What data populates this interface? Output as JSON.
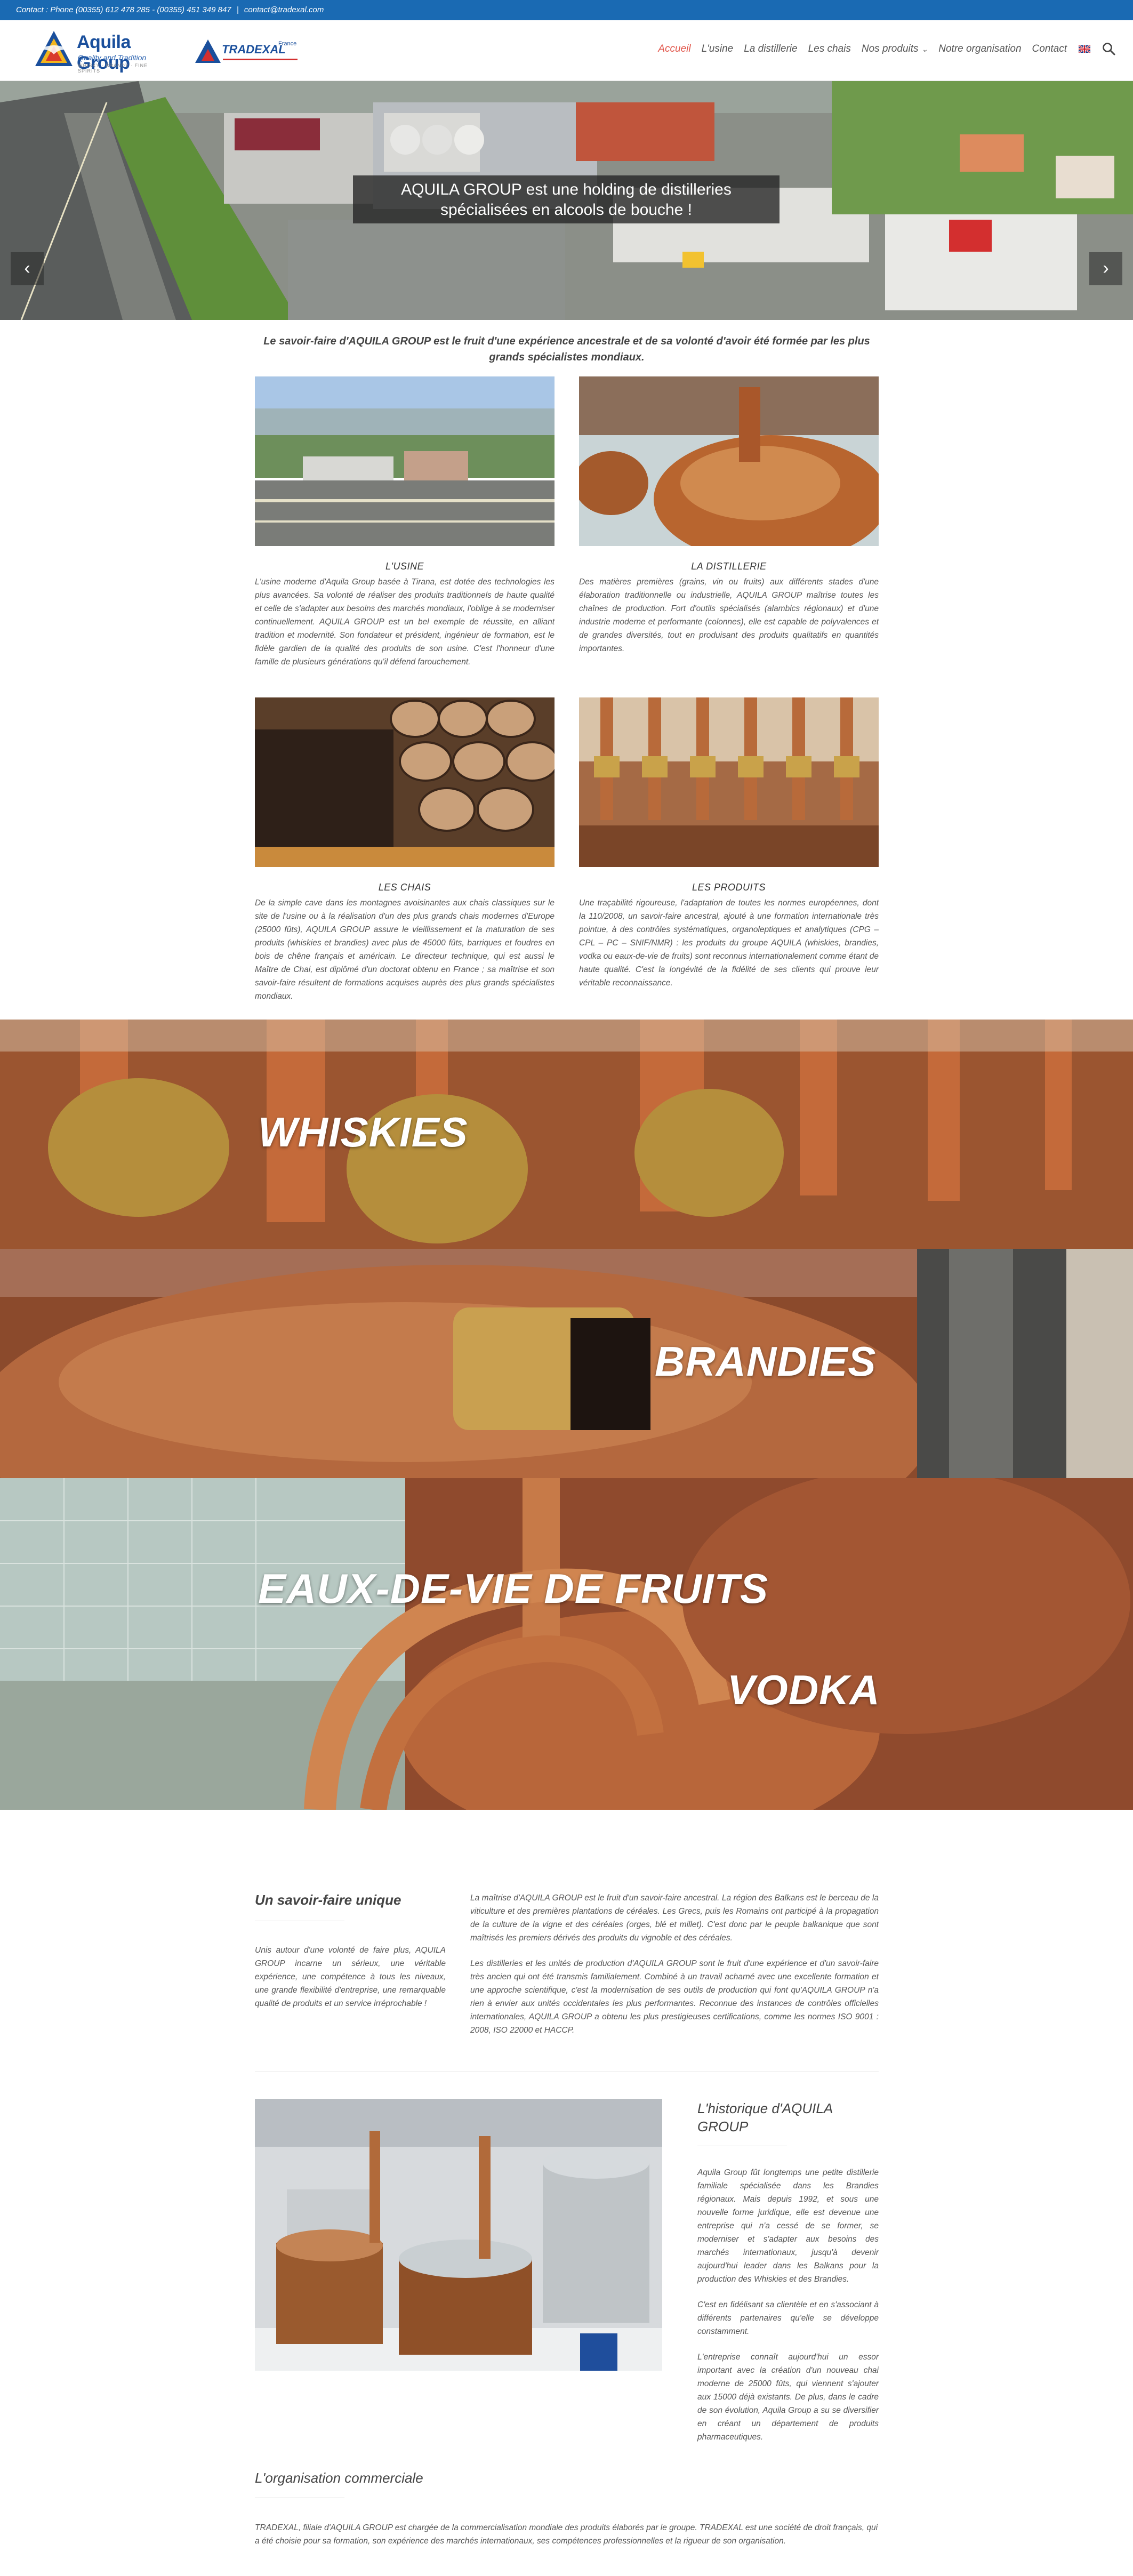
{
  "topbar": {
    "contact_label": "Contact : Phone (00355) 612 478 285 - (00355) 451 349 847",
    "separator": "|",
    "email": "contact@tradexal.com"
  },
  "header": {
    "logo_name": "Aquila Group",
    "logo_tagline": "Quality and Tradition",
    "logo_tagline2": "WHISKY · BRANDY · FINE SPIRITS",
    "logo2_name": "TRADEXAL",
    "logo2_sup": "France"
  },
  "nav": {
    "items": [
      "Accueil",
      "L'usine",
      "La distillerie",
      "Les chais",
      "Nos produits",
      "Notre organisation",
      "Contact"
    ],
    "active": "Accueil"
  },
  "hero": {
    "caption_line1": "AQUILA GROUP est une holding de distilleries",
    "caption_line2": "spécialisées en alcools de bouche !",
    "prev_label": "‹",
    "next_label": "›"
  },
  "intro": "Le savoir-faire d'AQUILA GROUP est le fruit d'une expérience ancestrale et de sa volonté d'avoir été formée par les plus grands spécialistes mondiaux.",
  "blocks": [
    {
      "title": "L'USINE",
      "text": "L'usine moderne d'Aquila Group basée à Tirana, est dotée des technologies les plus avancées. Sa volonté de réaliser des produits traditionnels de haute qualité et celle de s'adapter aux besoins des marchés mondiaux, l'oblige à se moderniser continuellement. AQUILA GROUP est un bel exemple de réussite, en alliant tradition et modernité. Son fondateur et président, ingénieur de formation, est le fidèle gardien de la qualité des produits de son usine. C'est l'honneur d'une famille de plusieurs générations qu'il défend farouchement."
    },
    {
      "title": "LA DISTILLERIE",
      "text": "Des matières premières (grains, vin ou fruits) aux différents stades d'une élaboration traditionnelle ou industrielle, AQUILA GROUP maîtrise toutes les chaînes de production. Fort d'outils spécialisés (alambics régionaux) et d'une industrie moderne et performante (colonnes), elle est capable de polyvalences et de grandes diversités, tout en produisant des produits qualitatifs en quantités importantes."
    },
    {
      "title": "LES CHAIS",
      "text": "De la simple cave dans les montagnes avoisinantes aux chais classiques sur le site de l'usine ou à la réalisation d'un des plus grands chais modernes d'Europe (25000 fûts), AQUILA GROUP assure le vieillissement et la maturation de ses produits (whiskies et brandies) avec plus de 45000 fûts, barriques et foudres en bois de chêne français et américain. Le directeur technique, qui est aussi le Maître de Chai, est diplômé d'un doctorat obtenu en France ; sa maîtrise et son savoir-faire résultent de formations acquises auprès des plus grands spécialistes mondiaux."
    },
    {
      "title": "LES PRODUITS",
      "text": "Une traçabilité rigoureuse, l'adaptation de toutes les normes européennes, dont la 110/2008, un savoir-faire ancestral, ajouté à une formation internationale très pointue, à des contrôles systématiques, organoleptiques et analytiques (CPG – CPL – PC – SNIF/NMR) : les produits du groupe AQUILA (whiskies, brandies, vodka ou eaux-de-vie de fruits) sont reconnus internationalement comme étant de haute qualité. C'est la longévité de la fidélité de ses clients qui prouve leur véritable reconnaissance."
    }
  ],
  "banners": {
    "whiskies": "WHISKIES",
    "brandies": "BRANDIES",
    "fruits": "EAUX-DE-VIE DE FRUITS",
    "vodka": "VODKA"
  },
  "savoir_faire": {
    "title": "Un savoir-faire unique",
    "left_text": "Unis autour d'une volonté de faire plus, AQUILA GROUP incarne un sérieux, une véritable expérience, une compétence à tous les niveaux, une grande flexibilité d'entreprise, une remarquable qualité de produits et un service irréprochable !",
    "right_p1": "La maîtrise d'AQUILA GROUP est le fruit d'un savoir-faire ancestral. La région des Balkans est le berceau de la viticulture et des premières plantations de céréales. Les Grecs, puis les Romains ont participé à la propagation de la culture de la vigne et des céréales (orges, blé et millet). C'est donc par le peuple balkanique que sont maîtrisés les premiers dérivés des produits du vignoble et des céréales.",
    "right_p2": "Les distilleries et les unités de production d'AQUILA GROUP sont le fruit d'une expérience et d'un savoir-faire très ancien qui ont été transmis familialement. Combiné à un travail acharné avec une excellente formation et une approche scientifique, c'est la modernisation de ses outils de production qui font qu'AQUILA GROUP n'a rien à envier aux unités occidentales les plus performantes. Reconnue des instances de contrôles officielles internationales, AQUILA GROUP a obtenu les plus prestigieuses certifications, comme les normes ISO 9001 : 2008, ISO 22000 et HACCP."
  },
  "historique": {
    "title": "L'historique d'AQUILA GROUP",
    "p1": "Aquila Group fût longtemps une petite distillerie familiale spécialisée dans les Brandies régionaux. Mais depuis 1992, et sous une nouvelle forme juridique, elle est devenue une entreprise qui n'a cessé de se former, se moderniser et s'adapter aux besoins des marchés internationaux, jusqu'à devenir aujourd'hui leader dans les Balkans pour la production des Whiskies et des Brandies.",
    "p2": "C'est en fidélisant sa clientèle et en s'associant à différents partenaires qu'elle se développe constamment.",
    "p3": "L'entreprise connaît aujourd'hui un essor important avec la création d'un nouveau chai moderne de 25000 fûts, qui viennent s'ajouter aux 15000 déjà existants. De plus, dans le cadre de son évolution, Aquila Group a su se diversifier en créant un département de produits pharmaceutiques."
  },
  "organisation": {
    "title": "L'organisation commerciale",
    "text": "TRADEXAL, filiale d'AQUILA GROUP est chargée de la commercialisation mondiale des produits élaborés par le groupe. TRADEXAL est une société de droit français, qui a été choisie pour sa formation, son expérience des marchés internationaux, ses compétences professionnelles et la rigueur de son organisation."
  },
  "colors": {
    "topbar": "#1a6ab3",
    "nav_active": "#e2574c",
    "copper": "#b5602f",
    "brand_blue": "#1a4f9c"
  }
}
